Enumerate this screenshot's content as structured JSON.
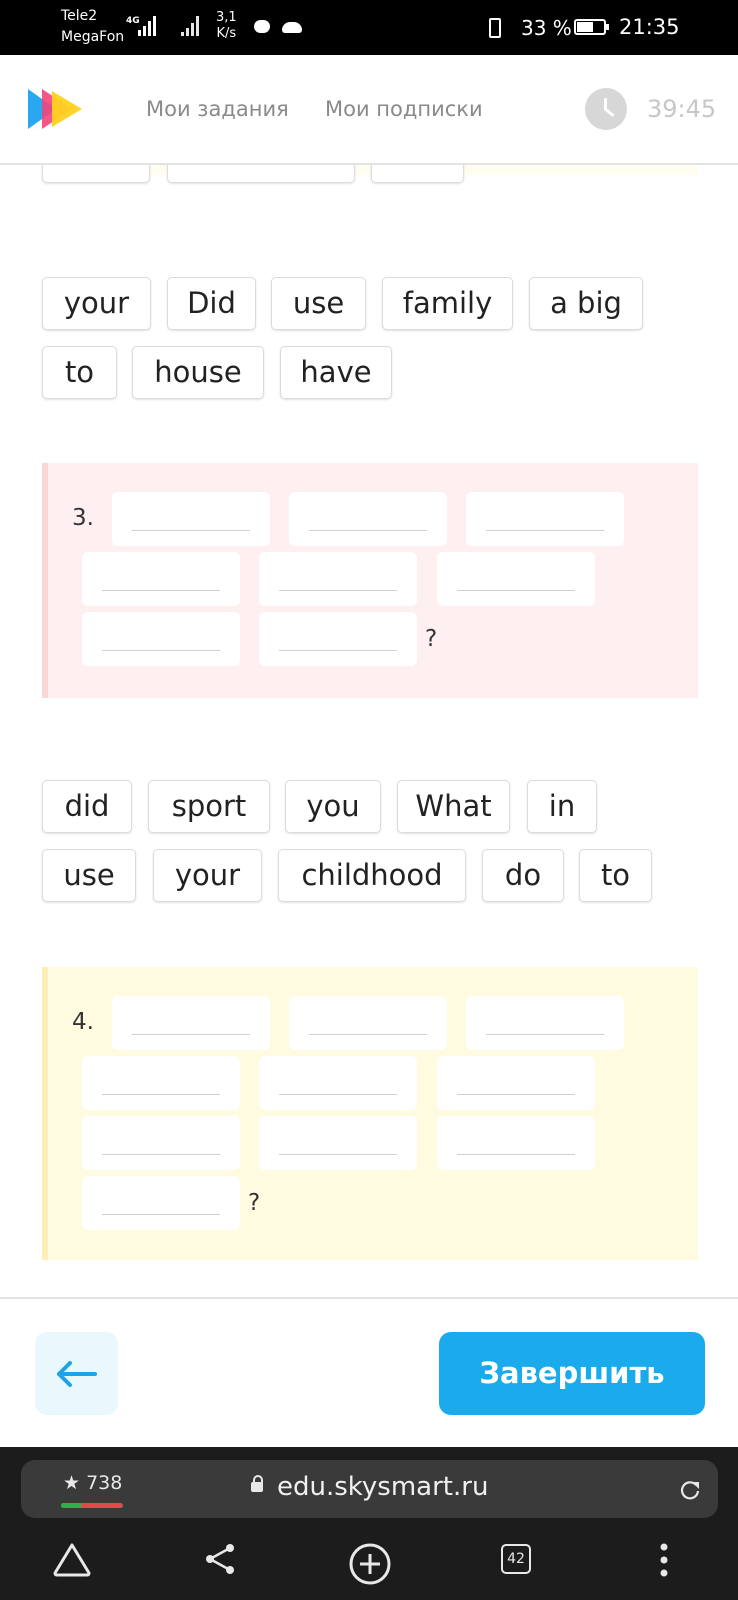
{
  "status_bar": {
    "carrier1": "Tele2",
    "carrier2": "MegaFon",
    "network": "4G",
    "speed_value": "3,1",
    "speed_unit": "K/s",
    "battery": "33 %",
    "time": "21:35"
  },
  "header": {
    "nav": [
      "Мои задания",
      "Мои подписки"
    ],
    "timer": "39:45"
  },
  "word_bank_2": [
    "your",
    "Did",
    "use",
    "family",
    "a big",
    "to",
    "house",
    "have"
  ],
  "question_3": {
    "number": "3.",
    "slot_count": 8,
    "end_mark": "?"
  },
  "word_bank_3": [
    "did",
    "sport",
    "you",
    "What",
    "in",
    "use",
    "your",
    "childhood",
    "do",
    "to"
  ],
  "question_4": {
    "number": "4.",
    "slot_count": 10,
    "end_mark": "?"
  },
  "footer": {
    "finish_label": "Завершить"
  },
  "browser": {
    "rating": "★ 738",
    "url": "edu.skysmart.ru",
    "tab_count": "42"
  },
  "colors": {
    "accent": "#19abec",
    "pink_card": "#fef0f0",
    "yellow_card": "#fffbe0"
  }
}
